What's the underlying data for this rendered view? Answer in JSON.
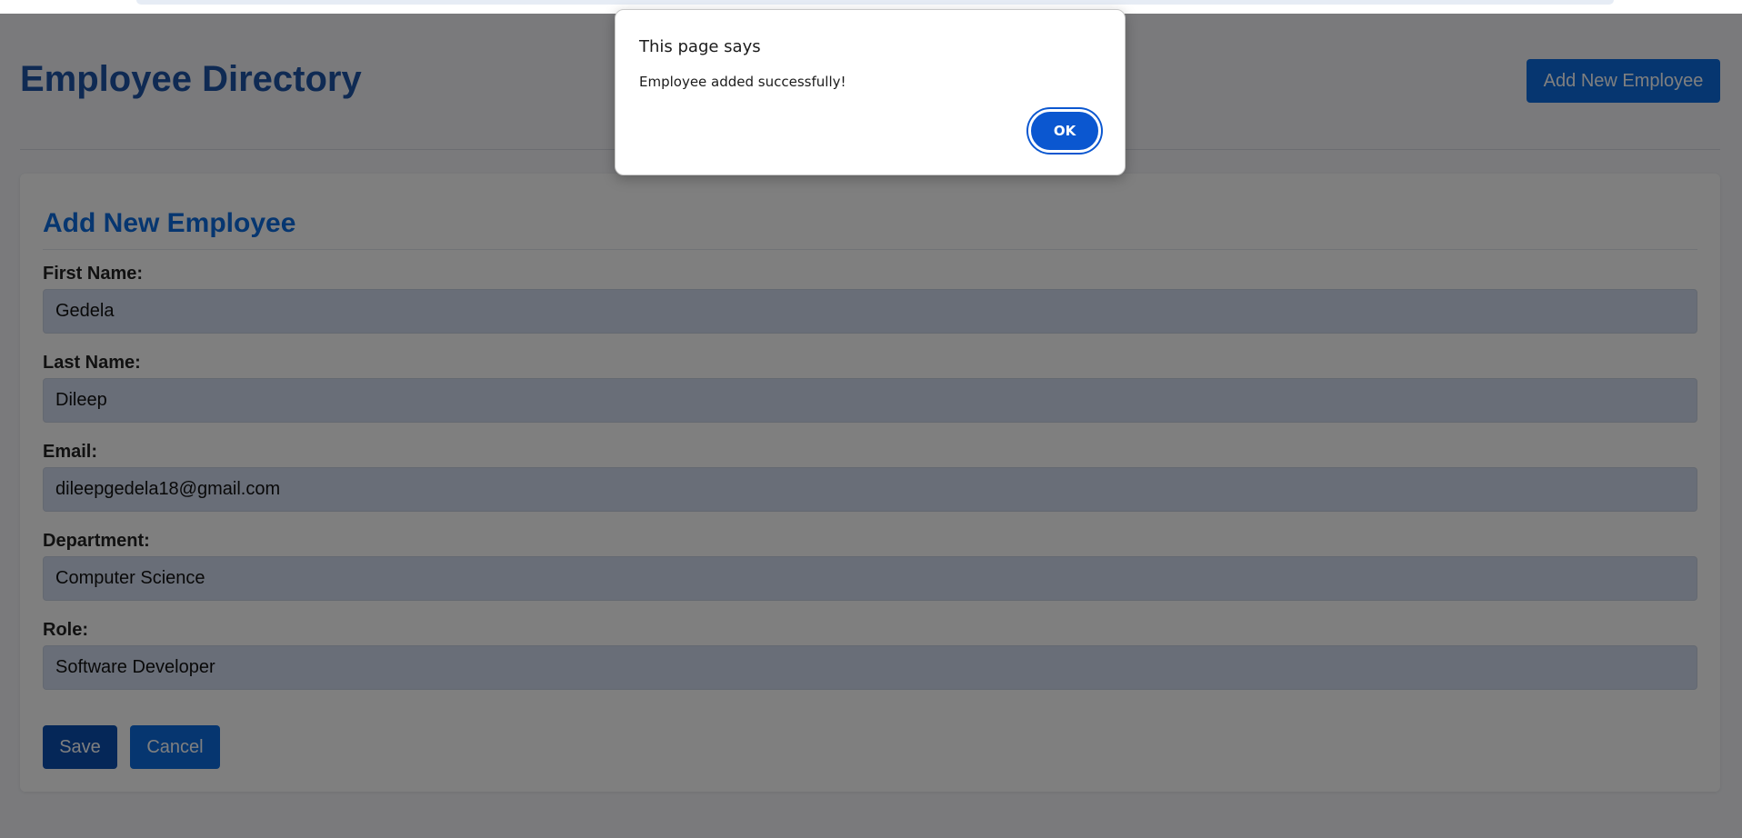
{
  "header": {
    "title": "Employee Directory",
    "add_button_label": "Add New Employee"
  },
  "form": {
    "title": "Add New Employee",
    "fields": [
      {
        "label": "First Name:",
        "value": "Gedela"
      },
      {
        "label": "Last Name:",
        "value": "Dileep"
      },
      {
        "label": "Email:",
        "value": "dileepgedela18@gmail.com"
      },
      {
        "label": "Department:",
        "value": "Computer Science"
      },
      {
        "label": "Role:",
        "value": "Software Developer"
      }
    ],
    "save_label": "Save",
    "cancel_label": "Cancel"
  },
  "dialog": {
    "title": "This page says",
    "message": "Employee added successfully!",
    "ok_label": "OK"
  },
  "colors": {
    "primary": "#0c6ce0",
    "title": "#1f55a6",
    "dialog_button": "#0b57d0"
  }
}
